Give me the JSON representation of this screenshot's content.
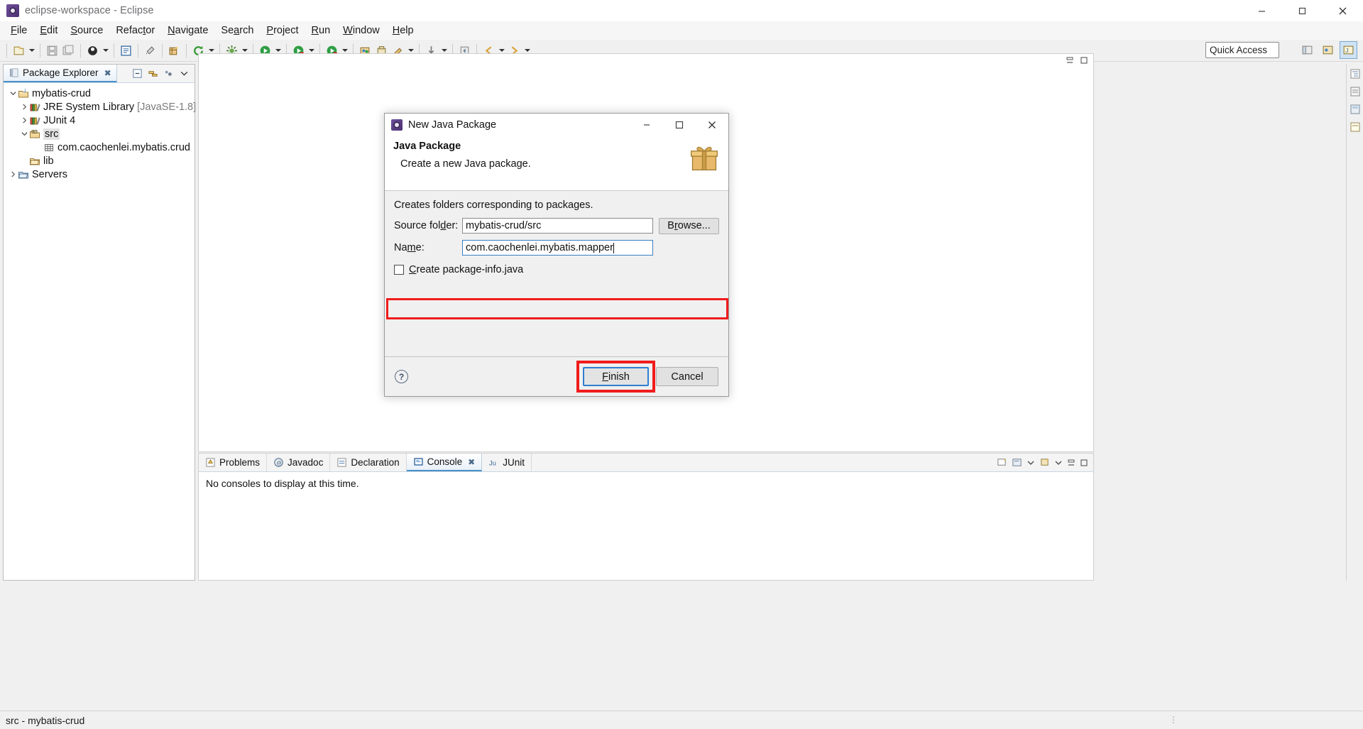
{
  "window": {
    "title": "eclipse-workspace - Eclipse",
    "icon": "eclipse-icon",
    "controls": {
      "minimize": "minimize-icon",
      "maximize": "maximize-icon",
      "close": "close-icon"
    }
  },
  "menubar": {
    "items": [
      {
        "label": "File",
        "mnemonic": "F"
      },
      {
        "label": "Edit",
        "mnemonic": "E"
      },
      {
        "label": "Source",
        "mnemonic": "S"
      },
      {
        "label": "Refactor",
        "mnemonic": "t"
      },
      {
        "label": "Navigate",
        "mnemonic": "N"
      },
      {
        "label": "Search",
        "mnemonic": "a"
      },
      {
        "label": "Project",
        "mnemonic": "P"
      },
      {
        "label": "Run",
        "mnemonic": "R"
      },
      {
        "label": "Window",
        "mnemonic": "W"
      },
      {
        "label": "Help",
        "mnemonic": "H"
      }
    ]
  },
  "toolbar": {
    "quick_access_placeholder": "Quick Access",
    "icons": [
      "new-wizard-icon",
      "save-icon",
      "save-all-icon",
      "debug-icon",
      "open-type-icon",
      "link-icon",
      "new-java-package-icon",
      "refresh-icon",
      "external-tools-icon",
      "run-icon",
      "debug-run-icon",
      "coverage-icon",
      "open-perspective-icon",
      "skip-breakpoints-icon",
      "search-icon",
      "next-annotation-icon",
      "back-icon",
      "forward-icon"
    ]
  },
  "package_explorer": {
    "tab_label": "Package Explorer",
    "tab_close": "✖",
    "tools": [
      "collapse-all-icon",
      "link-with-editor-icon",
      "view-menu-icon",
      "view-chevron-icon"
    ],
    "tree": [
      {
        "label": "mybatis-crud",
        "icon": "java-project-icon",
        "indent": 0,
        "twisty": "open",
        "selected": false,
        "suffix": ""
      },
      {
        "label": "JRE System Library",
        "icon": "library-icon",
        "indent": 1,
        "twisty": "closed",
        "selected": false,
        "suffix": "[JavaSE-1.8]"
      },
      {
        "label": "JUnit 4",
        "icon": "library-icon",
        "indent": 1,
        "twisty": "closed",
        "selected": false,
        "suffix": ""
      },
      {
        "label": "src",
        "icon": "source-folder-icon",
        "indent": 1,
        "twisty": "open",
        "selected": true,
        "suffix": ""
      },
      {
        "label": "com.caochenlei.mybatis.crud",
        "icon": "package-icon",
        "indent": 2,
        "twisty": "none",
        "selected": false,
        "suffix": ""
      },
      {
        "label": "lib",
        "icon": "folder-icon",
        "indent": 1,
        "twisty": "none",
        "selected": false,
        "suffix": ""
      },
      {
        "label": "Servers",
        "icon": "folder-icon",
        "indent": 0,
        "twisty": "closed",
        "selected": false,
        "suffix": ""
      }
    ]
  },
  "console_panel": {
    "tabs": [
      {
        "label": "Problems",
        "icon": "problems-icon",
        "active": false,
        "close": ""
      },
      {
        "label": "Javadoc",
        "icon": "javadoc-icon",
        "active": false,
        "close": ""
      },
      {
        "label": "Declaration",
        "icon": "declaration-icon",
        "active": false,
        "close": ""
      },
      {
        "label": "Console",
        "icon": "console-icon",
        "active": true,
        "close": "✖"
      },
      {
        "label": "JUnit",
        "icon": "junit-icon",
        "active": false,
        "close": ""
      }
    ],
    "message": "No consoles to display at this time.",
    "tools": [
      "new-console-icon",
      "display-console-icon",
      "open-console-chevron-icon",
      "pin-console-icon",
      "view-menu-icon",
      "minimize-icon",
      "maximize-icon"
    ]
  },
  "statusbar": {
    "text": "src - mybatis-crud"
  },
  "dialog": {
    "window_title": "New Java Package",
    "window_icon": "eclipse-icon",
    "controls": {
      "minimize": "minimize-icon",
      "maximize": "maximize-icon",
      "close": "close-icon"
    },
    "heading": "Java Package",
    "subheading": "Create a new Java package.",
    "banner_icon": "package-wizard-gift-icon",
    "description": "Creates folders corresponding to packages.",
    "fields": {
      "source_folder": {
        "label": "Source folder:",
        "mnemonic": "d",
        "value": "mybatis-crud/src",
        "browse_label": "Browse...",
        "browse_mnemonic": "r"
      },
      "name": {
        "label": "Name:",
        "mnemonic": "m",
        "value": "com.caochenlei.mybatis.mapper",
        "highlighted": true
      }
    },
    "checkbox": {
      "label": "Create package-info.java",
      "mnemonic": "C",
      "checked": false
    },
    "help_icon": "help-icon",
    "buttons": {
      "finish": {
        "label": "Finish",
        "mnemonic": "F",
        "default": true,
        "highlighted": true
      },
      "cancel": {
        "label": "Cancel"
      }
    }
  },
  "colors": {
    "highlight_red": "#f01c1c",
    "focus_blue": "#2f7fd0",
    "tab_accent": "#4a90c8",
    "panel_bg": "#f0f0f0"
  }
}
